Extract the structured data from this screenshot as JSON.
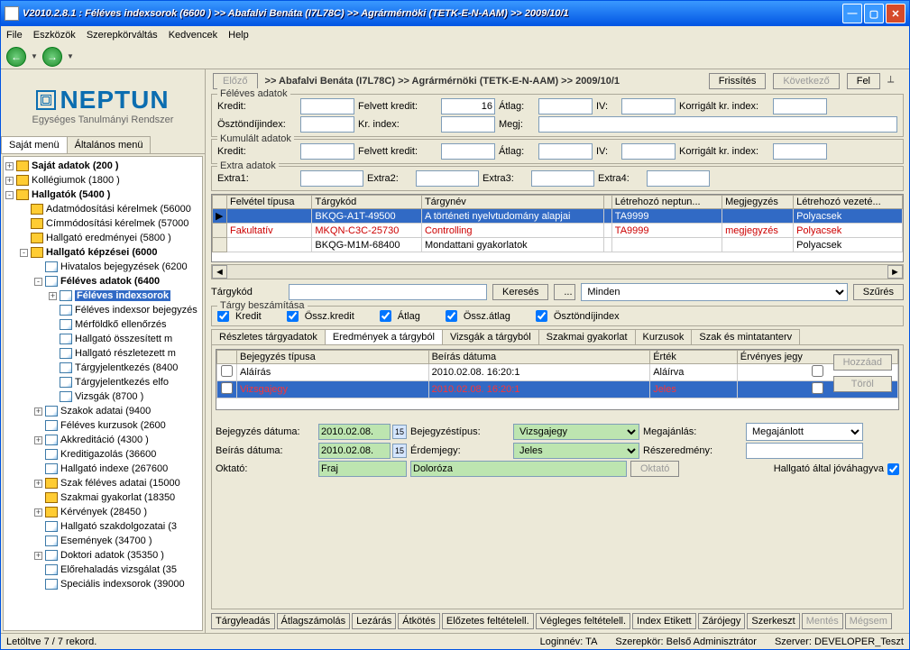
{
  "title": "V2010.2.8.1 : Féléves indexsorok (6600  )  >> Abafalvi Benáta (I7L78C) >> Agrármérnöki (TETK-E-N-AAM) >> 2009/10/1",
  "menu": [
    "File",
    "Eszközök",
    "Szerepkörváltás",
    "Kedvencek",
    "Help"
  ],
  "logo": {
    "title": "NEPTUN",
    "sub": "Egységes Tanulmányi Rendszer"
  },
  "left_tabs": [
    "Saját menü",
    "Általános menü"
  ],
  "tree": [
    {
      "ind": 0,
      "sq": "+",
      "ic": "f",
      "bold": true,
      "label": "Saját adatok (200  )"
    },
    {
      "ind": 0,
      "sq": "+",
      "ic": "f",
      "bold": false,
      "label": "Kollégiumok (1800  )"
    },
    {
      "ind": 0,
      "sq": "-",
      "ic": "f",
      "bold": true,
      "label": "Hallgatók (5400  )"
    },
    {
      "ind": 1,
      "sq": "",
      "ic": "f",
      "bold": false,
      "label": "Adatmódosítási kérelmek (56000"
    },
    {
      "ind": 1,
      "sq": "",
      "ic": "f",
      "bold": false,
      "label": "Címmódosítási kérelmek (57000"
    },
    {
      "ind": 1,
      "sq": "",
      "ic": "f",
      "bold": false,
      "label": "Hallgató eredményei (5800  )"
    },
    {
      "ind": 1,
      "sq": "-",
      "ic": "f",
      "bold": true,
      "label": "Hallgató képzései (6000"
    },
    {
      "ind": 2,
      "sq": "",
      "ic": "doc",
      "bold": false,
      "label": "Hivatalos bejegyzések (6200"
    },
    {
      "ind": 2,
      "sq": "-",
      "ic": "doc",
      "bold": true,
      "label": "Féléves adatok (6400"
    },
    {
      "ind": 3,
      "sq": "+",
      "ic": "doc",
      "bold": true,
      "label": "Féléves indexsorok",
      "sel": true
    },
    {
      "ind": 3,
      "sq": "",
      "ic": "doc",
      "bold": false,
      "label": "Féléves indexsor bejegyzés"
    },
    {
      "ind": 3,
      "sq": "",
      "ic": "doc",
      "bold": false,
      "label": "Mérföldkő ellenőrzés"
    },
    {
      "ind": 3,
      "sq": "",
      "ic": "doc",
      "bold": false,
      "label": "Hallgató összesített m"
    },
    {
      "ind": 3,
      "sq": "",
      "ic": "doc",
      "bold": false,
      "label": "Hallgató részletezett m"
    },
    {
      "ind": 3,
      "sq": "",
      "ic": "doc",
      "bold": false,
      "label": "Tárgyjelentkezés (8400"
    },
    {
      "ind": 3,
      "sq": "",
      "ic": "doc",
      "bold": false,
      "label": "Tárgyjelentkezés elfo"
    },
    {
      "ind": 3,
      "sq": "",
      "ic": "doc",
      "bold": false,
      "label": "Vizsgák (8700  )"
    },
    {
      "ind": 2,
      "sq": "+",
      "ic": "doc",
      "bold": false,
      "label": "Szakok adatai (9400"
    },
    {
      "ind": 2,
      "sq": "",
      "ic": "doc",
      "bold": false,
      "label": "Féléves kurzusok (2600"
    },
    {
      "ind": 2,
      "sq": "+",
      "ic": "doc",
      "bold": false,
      "label": "Akkreditáció (4300  )"
    },
    {
      "ind": 2,
      "sq": "",
      "ic": "doc",
      "bold": false,
      "label": "Kreditigazolás (36600"
    },
    {
      "ind": 2,
      "sq": "",
      "ic": "doc",
      "bold": false,
      "label": "Hallgató indexe (267600"
    },
    {
      "ind": 2,
      "sq": "+",
      "ic": "f",
      "bold": false,
      "label": "Szak féléves adatai (15000"
    },
    {
      "ind": 2,
      "sq": "",
      "ic": "f",
      "bold": false,
      "label": "Szakmai gyakorlat (18350"
    },
    {
      "ind": 2,
      "sq": "+",
      "ic": "f",
      "bold": false,
      "label": "Kérvények (28450  )"
    },
    {
      "ind": 2,
      "sq": "",
      "ic": "doc",
      "bold": false,
      "label": "Hallgató szakdolgozatai (3"
    },
    {
      "ind": 2,
      "sq": "",
      "ic": "doc",
      "bold": false,
      "label": "Események (34700  )"
    },
    {
      "ind": 2,
      "sq": "+",
      "ic": "doc",
      "bold": false,
      "label": "Doktori adatok (35350  )"
    },
    {
      "ind": 2,
      "sq": "",
      "ic": "doc",
      "bold": false,
      "label": "Előrehaladás vizsgálat (35"
    },
    {
      "ind": 2,
      "sq": "",
      "ic": "doc",
      "bold": false,
      "label": "Speciális indexsorok (39000"
    }
  ],
  "header": {
    "prev": "Előző",
    "breadcrumb": ">> Abafalvi Benáta (I7L78C) >> Agrármérnöki (TETK-E-N-AAM) >> 2009/10/1",
    "refresh": "Frissítés",
    "next": "Következő",
    "up": "Fel"
  },
  "fgs": {
    "feleves": {
      "legend": "Féléves adatok",
      "kredit": "Kredit:",
      "felvett": "Felvett kredit:",
      "felvett_val": "16",
      "atlag": "Átlag:",
      "iv": "IV:",
      "korr": "Korrigált kr. index:",
      "osztondij": "Ösztöndíjindex:",
      "krindex": "Kr. index:",
      "megj": "Megj:"
    },
    "kumulalt": {
      "legend": "Kumulált adatok",
      "kredit": "Kredit:",
      "felvett": "Felvett kredit:",
      "atlag": "Átlag:",
      "iv": "IV:",
      "korr": "Korrigált kr. index:"
    },
    "extra": {
      "legend": "Extra adatok",
      "e1": "Extra1:",
      "e2": "Extra2:",
      "e3": "Extra3:",
      "e4": "Extra4:"
    }
  },
  "grid": {
    "cols": [
      "",
      "Felvétel típusa",
      "Tárgykód",
      "Tárgynév",
      "",
      "Létrehozó neptun...",
      "Megjegyzés",
      "Létrehozó vezeté..."
    ],
    "rows": [
      {
        "sel": true,
        "red": false,
        "c": [
          "",
          "",
          "BKQG-A1T-49500",
          "A történeti nyelvtudomány alapjai",
          "",
          "TA9999",
          "",
          "Polyacsek"
        ]
      },
      {
        "sel": false,
        "red": true,
        "c": [
          "",
          "Fakultatív",
          "MKQN-C3C-25730",
          "Controlling",
          "",
          "TA9999",
          "megjegyzés",
          "Polyacsek"
        ]
      },
      {
        "sel": false,
        "red": false,
        "c": [
          "",
          "",
          "BKQG-M1M-68400",
          "Mondattani gyakorlatok",
          "",
          "",
          "",
          "Polyacsek"
        ]
      }
    ]
  },
  "search": {
    "label": "Tárgykód",
    "input": "",
    "btn": "Keresés",
    "ell": "...",
    "filter": "Minden",
    "szures": "Szűrés"
  },
  "targy": {
    "legend": "Tárgy beszámítása",
    "c1": "Kredit",
    "c2": "Össz.kredit",
    "c3": "Átlag",
    "c4": "Össz.átlag",
    "c5": "Ösztöndíjindex"
  },
  "subtabs": [
    "Részletes tárgyadatok",
    "Eredmények a tárgyból",
    "Vizsgák a tárgyból",
    "Szakmai gyakorlat",
    "Kurzusok",
    "Szak és mintatanterv"
  ],
  "grid2": {
    "cols": [
      "",
      "Bejegyzés típusa",
      "Beírás dátuma",
      "Érték",
      "Érvényes jegy"
    ],
    "rows": [
      {
        "sel": false,
        "c": [
          "",
          "Aláírás",
          "2010.02.08. 16:20:1",
          "Aláírva",
          ""
        ]
      },
      {
        "sel": true,
        "c": [
          "",
          "Vizsgajegy",
          "2010.02.08. 16:20:1",
          "Jeles",
          ""
        ]
      }
    ],
    "hozzaad": "Hozzáad",
    "torol": "Töröl"
  },
  "form": {
    "bejdat": "Bejegyzés dátuma:",
    "bejdat_v": "2010.02.08.",
    "beirdat": "Beírás dátuma:",
    "beirdat_v": "2010.02.08.",
    "bejtip": "Bejegyzéstípus:",
    "bejtip_v": "Vizsgajegy",
    "erdjegy": "Érdemjegy:",
    "erdjegy_v": "Jeles",
    "megaj": "Megajánlás:",
    "megaj_v": "Megajánlott",
    "reszered": "Részeredmény:",
    "oktato": "Oktató:",
    "okt1": "Fraj",
    "okt2": "Doloróza",
    "oktbtn": "Oktató",
    "jovahagy": "Hallgató által jóváhagyva"
  },
  "bottom_btns": [
    "Tárgyleadás",
    "Átlagszámolás",
    "Lezárás",
    "Átkötés",
    "Előzetes feltételell.",
    "Végleges feltételell.",
    "Index Etikett",
    "Zárójegy",
    "Szerkeszt",
    "Mentés",
    "Mégsem"
  ],
  "status": {
    "records": "Letöltve 7 / 7 rekord.",
    "login": "Loginnév: TA",
    "role": "Szerepkör: Belső Adminisztrátor",
    "server": "Szerver: DEVELOPER_Teszt"
  }
}
